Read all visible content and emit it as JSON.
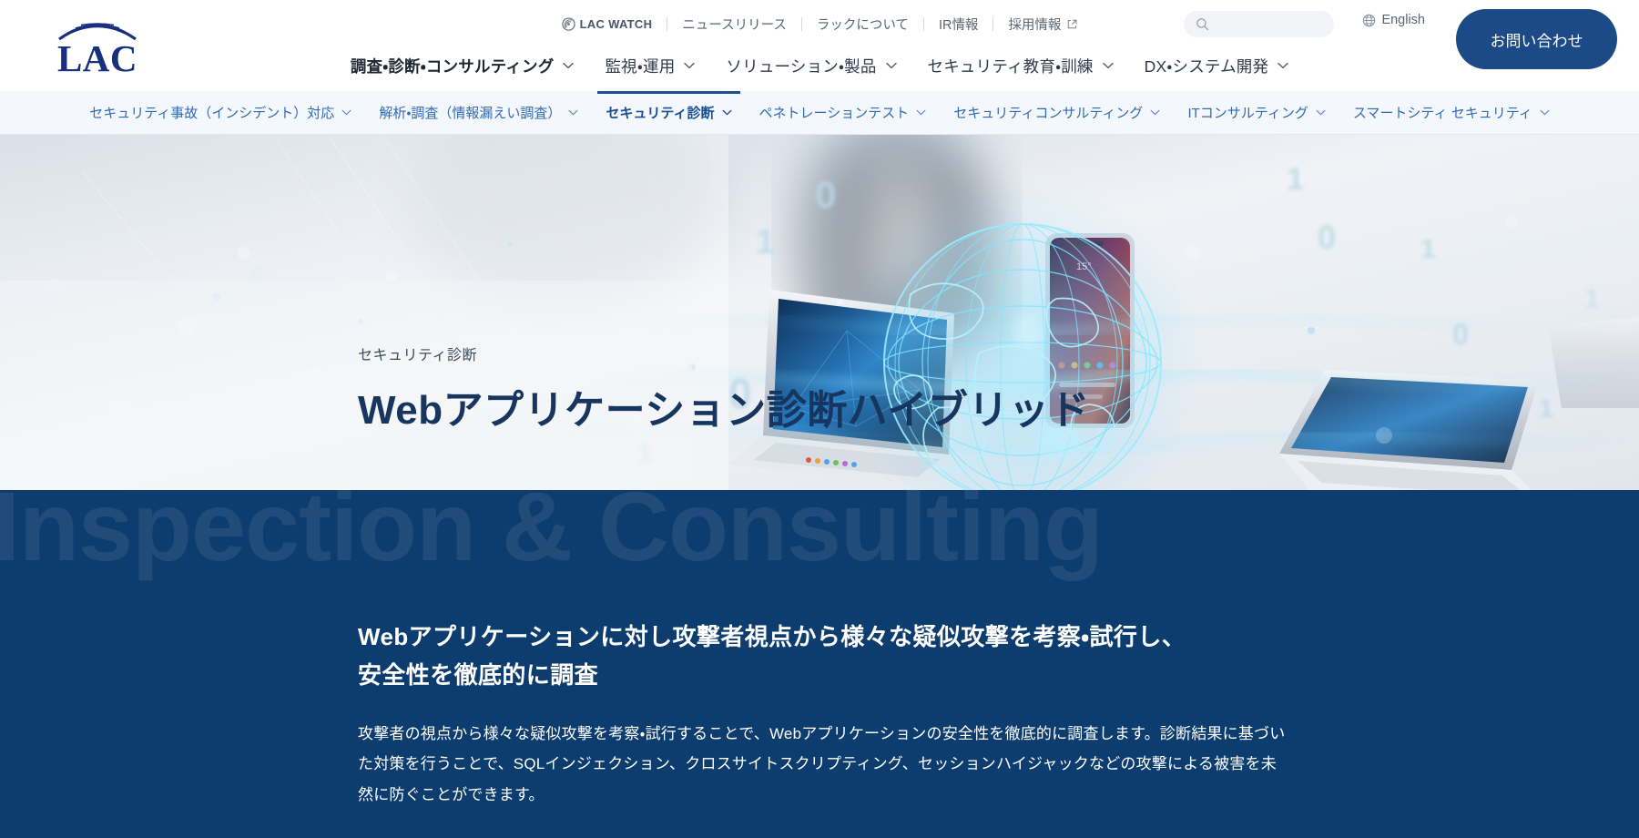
{
  "brand": {
    "logo_text": "LAC",
    "logo_icon": "lac-arc-logo"
  },
  "utility_nav": {
    "items": [
      {
        "label": "LAC WATCH",
        "icon": "lac-watch-icon",
        "external": false
      },
      {
        "label": "ニュースリリース",
        "icon": null,
        "external": false
      },
      {
        "label": "ラックについて",
        "icon": null,
        "external": false
      },
      {
        "label": "IR情報",
        "icon": null,
        "external": false
      },
      {
        "label": "採用情報",
        "icon": "external-link-icon",
        "external": true
      }
    ]
  },
  "search": {
    "value": "",
    "placeholder": "",
    "icon": "search-icon"
  },
  "language": {
    "label": "English",
    "icon": "globe-icon"
  },
  "contact_button": {
    "label": "お問い合わせ"
  },
  "main_nav": {
    "items": [
      {
        "label": "調査・診断・コンサルティング",
        "active": true,
        "chevron": "chevron-down-icon"
      },
      {
        "label": "監視・運用",
        "active": false,
        "chevron": "chevron-down-icon"
      },
      {
        "label": "ソリューション・製品",
        "active": false,
        "chevron": "chevron-down-icon"
      },
      {
        "label": "セキュリティ教育・訓練",
        "active": false,
        "chevron": "chevron-down-icon"
      },
      {
        "label": "DX・システム開発",
        "active": false,
        "chevron": "chevron-down-icon"
      }
    ]
  },
  "sub_nav": {
    "items": [
      {
        "label": "セキュリティ事故（インシデント）対応",
        "active": false,
        "chevron": "chevron-down-icon"
      },
      {
        "label": "解析・調査（情報漏えい調査）",
        "active": false,
        "chevron": "chevron-down-icon"
      },
      {
        "label": "セキュリティ診断",
        "active": true,
        "chevron": "chevron-down-icon"
      },
      {
        "label": "ペネトレーションテスト",
        "active": false,
        "chevron": "chevron-down-icon"
      },
      {
        "label": "セキュリティコンサルティング",
        "active": false,
        "chevron": "chevron-down-icon"
      },
      {
        "label": "ITコンサルティング",
        "active": false,
        "chevron": "chevron-down-icon"
      },
      {
        "label": "スマートシティ セキュリティ",
        "active": false,
        "chevron": "chevron-down-icon"
      }
    ]
  },
  "hero": {
    "eyebrow": "セキュリティ診断",
    "title": "Webアプリケーション診断ハイブリッド",
    "background_description": "laptops, smartphone and glowing cyan wireframe globe with binary digits"
  },
  "section": {
    "watermark": "Inspection & Consulting",
    "heading_line1": "Webアプリケーションに対し攻撃者視点から様々な疑似攻撃を考察・試行し、",
    "heading_line2": "安全性を徹底的に調査",
    "paragraph": "攻撃者の視点から様々な疑似攻撃を考察・試行することで、Webアプリケーションの安全性を徹底的に調査します。診断結果に基づいた対策を行うことで、SQLインジェクション、クロスサイトスクリプティング、セッションハイジャックなどの攻撃による被害を未然に防ぐことができます。"
  },
  "colors": {
    "brand_navy": "#17307e",
    "section_navy": "#0d3c6e",
    "accent_blue": "#1c4f91",
    "subnav_bg": "#f4f7fb",
    "link_blue": "#2f6bb5",
    "hero_title": "#16355f"
  }
}
